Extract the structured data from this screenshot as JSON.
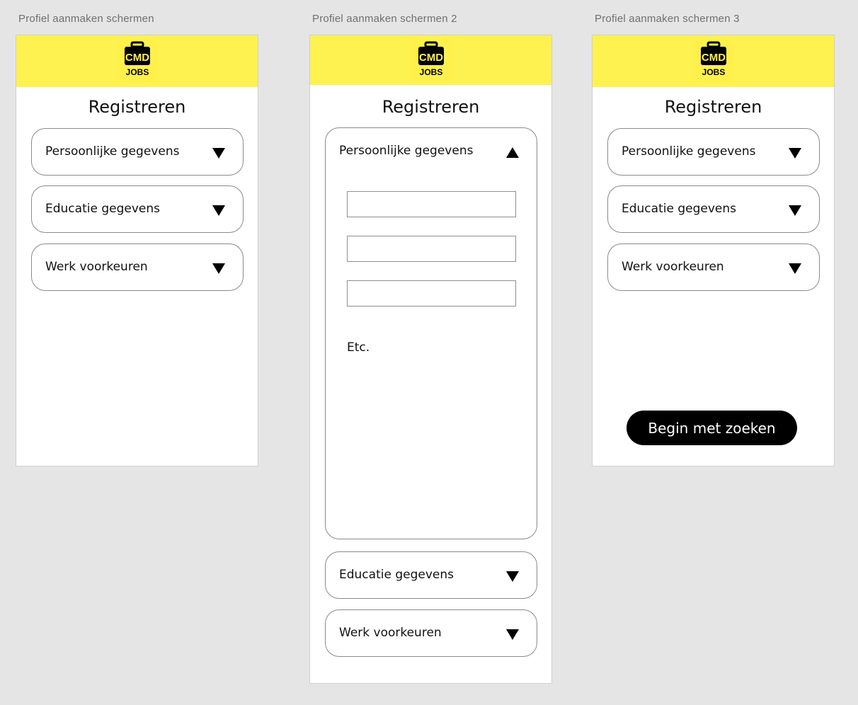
{
  "artboards": [
    {
      "label": "Profiel aanmaken schermen",
      "logo": {
        "top": "CMD",
        "bottom": "JOBS",
        "icon": "briefcase-icon"
      },
      "title": "Registreren",
      "sections": [
        {
          "label": "Persoonlijke gegevens",
          "icon": "triangle-down-icon"
        },
        {
          "label": "Educatie gegevens",
          "icon": "triangle-down-icon"
        },
        {
          "label": "Werk voorkeuren",
          "icon": "triangle-down-icon"
        }
      ]
    },
    {
      "label": "Profiel aanmaken schermen 2",
      "logo": {
        "top": "CMD",
        "bottom": "JOBS",
        "icon": "briefcase-icon"
      },
      "title": "Registreren",
      "sections": [
        {
          "label": "Persoonlijke gegevens",
          "icon": "triangle-up-icon",
          "expanded": true,
          "fields": [
            {
              "value": "",
              "placeholder": ""
            },
            {
              "value": "",
              "placeholder": ""
            },
            {
              "value": "",
              "placeholder": ""
            }
          ],
          "etc_text": "Etc."
        },
        {
          "label": "Educatie gegevens",
          "icon": "triangle-down-icon"
        },
        {
          "label": "Werk voorkeuren",
          "icon": "triangle-down-icon"
        }
      ]
    },
    {
      "label": "Profiel aanmaken schermen 3",
      "logo": {
        "top": "CMD",
        "bottom": "JOBS",
        "icon": "briefcase-icon"
      },
      "title": "Registreren",
      "sections": [
        {
          "label": "Persoonlijke gegevens",
          "icon": "triangle-down-icon"
        },
        {
          "label": "Educatie gegevens",
          "icon": "triangle-down-icon"
        },
        {
          "label": "Werk voorkeuren",
          "icon": "triangle-down-icon"
        }
      ],
      "button_label": "Begin met zoeken"
    }
  ],
  "colors": {
    "background": "#e5e5e5",
    "header_yellow": "#fdf24f",
    "button_black": "#000000",
    "border_gray": "#8a8a8a"
  }
}
